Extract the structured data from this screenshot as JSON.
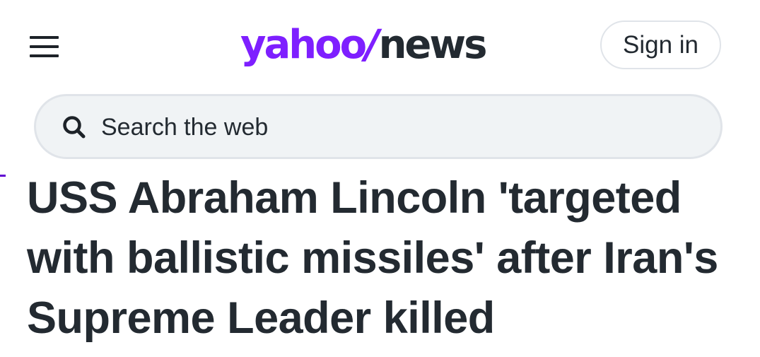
{
  "header": {
    "menu_icon": "hamburger-menu-icon",
    "logo": {
      "brand": "yahoo",
      "separator": "/",
      "section": "news",
      "brand_color": "#7e1fff",
      "section_color": "#232a31"
    },
    "sign_in_label": "Sign in"
  },
  "search": {
    "icon": "search-icon",
    "placeholder": "Search the web"
  },
  "article": {
    "headline": "USS Abraham Lincoln 'targeted with ballistic missiles' after Iran's Supreme Leader killed"
  },
  "colors": {
    "accent": "#7e1fff",
    "text": "#232a31",
    "search_bg": "#f0f3f5",
    "border": "#e0e4e9"
  }
}
